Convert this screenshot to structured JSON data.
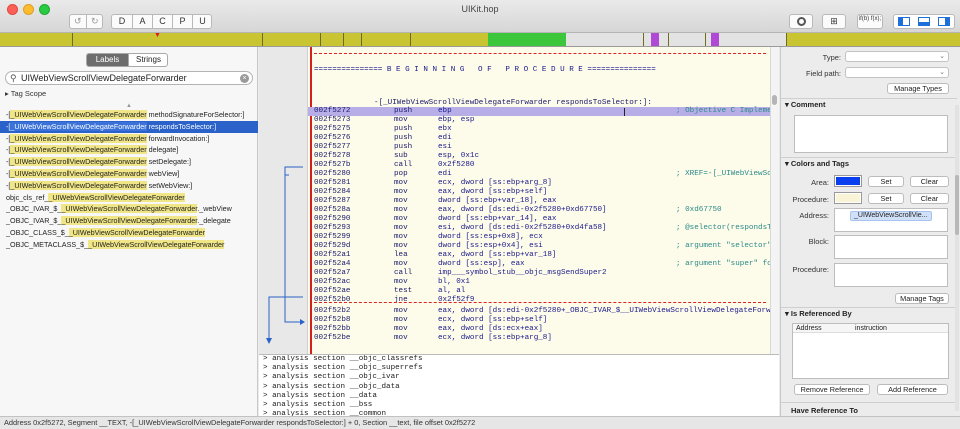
{
  "window": {
    "title": "UIKit.hop"
  },
  "toolbar": {
    "undo_icon": "undo-icon",
    "redo_icon": "redo-icon",
    "type_buttons": [
      "D",
      "A",
      "C",
      "P",
      "U"
    ],
    "right_icons": [
      "debug-icon",
      "control-flow-graph-icon",
      "pseudo-code-icon",
      "left-panel-toggle-icon",
      "bottom-panel-toggle-icon",
      "right-panel-toggle-icon"
    ],
    "pseudo_code_label": "if(b) f(x);"
  },
  "left": {
    "tabs": [
      "Labels",
      "Strings"
    ],
    "search_value": "UIWebViewScrollViewDelegateForwarder",
    "tag_scope": "Tag Scope",
    "symbols": [
      {
        "pre": "-[",
        "hl": "_UIWebViewScrollViewDelegateForwarder",
        "post": " methodSignatureForSelector:]"
      },
      {
        "pre": "-[",
        "hl": "_UIWebViewScrollViewDelegateForwarder",
        "post": " respondsToSelector:]"
      },
      {
        "pre": "-[",
        "hl": "_UIWebViewScrollViewDelegateForwarder",
        "post": " forwardInvocation:]"
      },
      {
        "pre": "-[",
        "hl": "_UIWebViewScrollViewDelegateForwarder",
        "post": " delegate]"
      },
      {
        "pre": "-[",
        "hl": "_UIWebViewScrollViewDelegateForwarder",
        "post": " setDelegate:]"
      },
      {
        "pre": "-[",
        "hl": "_UIWebViewScrollViewDelegateForwarder",
        "post": " webView]"
      },
      {
        "pre": "-[",
        "hl": "_UIWebViewScrollViewDelegateForwarder",
        "post": " setWebView:]"
      },
      {
        "pre": "objc_cls_ref_",
        "hl": "_UIWebViewScrollViewDelegateForwarder",
        "post": ""
      },
      {
        "pre": "_OBJC_IVAR_$_",
        "hl": "_UIWebViewScrollViewDelegateForwarder",
        "post": "._webView"
      },
      {
        "pre": "_OBJC_IVAR_$_",
        "hl": "_UIWebViewScrollViewDelegateForwarder",
        "post": "._delegate"
      },
      {
        "pre": "_OBJC_CLASS_$_",
        "hl": "_UIWebViewScrollViewDelegateForwarder",
        "post": ""
      },
      {
        "pre": "_OBJC_METACLASS_$_",
        "hl": "_UIWebViewScrollViewDelegateForwarder",
        "post": ""
      }
    ]
  },
  "code": {
    "banner": "=============== B E G I N N I N G   O F   P R O C E D U R E ===============",
    "proc_name": "-[_UIWebViewScrollViewDelegateForwarder respondsToSelector:]:",
    "lines": [
      {
        "addr": "002f5272",
        "mn": "push",
        "op": "ebp",
        "cm": "; Objective C Implemen"
      },
      {
        "addr": "002f5273",
        "mn": "mov",
        "op": "ebp, esp",
        "cm": ""
      },
      {
        "addr": "002f5275",
        "mn": "push",
        "op": "ebx",
        "cm": ""
      },
      {
        "addr": "002f5276",
        "mn": "push",
        "op": "edi",
        "cm": ""
      },
      {
        "addr": "002f5277",
        "mn": "push",
        "op": "esi",
        "cm": ""
      },
      {
        "addr": "002f5278",
        "mn": "sub",
        "op": "esp, 0x1c",
        "cm": ""
      },
      {
        "addr": "002f527b",
        "mn": "call",
        "op": "0x2f5280",
        "cm": ""
      },
      {
        "addr": "002f5280",
        "mn": "pop",
        "op": "edi",
        "cm": "; XREF=-[_UIWebViewScr"
      },
      {
        "addr": "002f5281",
        "mn": "mov",
        "op": "ecx, dword [ss:ebp+arg_8]",
        "cm": ""
      },
      {
        "addr": "002f5284",
        "mn": "mov",
        "op": "eax, dword [ss:ebp+self]",
        "cm": ""
      },
      {
        "addr": "002f5287",
        "mn": "mov",
        "op": "dword [ss:ebp+var_18], eax",
        "cm": ""
      },
      {
        "addr": "002f528a",
        "mn": "mov",
        "op": "eax, dword [ds:edi-0x2f5280+0xd67750]",
        "cm": "; 0xd67750"
      },
      {
        "addr": "002f5290",
        "mn": "mov",
        "op": "dword [ss:ebp+var_14], eax",
        "cm": ""
      },
      {
        "addr": "002f5293",
        "mn": "mov",
        "op": "esi, dword [ds:edi-0x2f5280+0xd4fa58]",
        "cm": "; @selector(respondsTo"
      },
      {
        "addr": "002f5299",
        "mn": "mov",
        "op": "dword [ss:esp+0x8], ecx",
        "cm": ""
      },
      {
        "addr": "002f529d",
        "mn": "mov",
        "op": "dword [ss:esp+0x4], esi",
        "cm": "; argument \"selector\""
      },
      {
        "addr": "002f52a1",
        "mn": "lea",
        "op": "eax, dword [ss:ebp+var_18]",
        "cm": ""
      },
      {
        "addr": "002f52a4",
        "mn": "mov",
        "op": "dword [ss:esp], eax",
        "cm": "; argument \"super\" for"
      },
      {
        "addr": "002f52a7",
        "mn": "call",
        "op": "imp___symbol_stub__objc_msgSendSuper2",
        "cm": ""
      },
      {
        "addr": "002f52ac",
        "mn": "mov",
        "op": "bl, 0x1",
        "cm": ""
      },
      {
        "addr": "002f52ae",
        "mn": "test",
        "op": "al, al",
        "cm": ""
      },
      {
        "addr": "002f52b0",
        "mn": "jne",
        "op": "0x2f52f9",
        "cm": ""
      }
    ],
    "lines2": [
      {
        "addr": "002f52b2",
        "mn": "mov",
        "op": "eax, dword [ds:edi-0x2f5280+_OBJC_IVAR_$__UIWebViewScrollViewDelegateForwa",
        "cm": ""
      },
      {
        "addr": "002f52b8",
        "mn": "mov",
        "op": "ecx, dword [ss:ebp+self]",
        "cm": ""
      },
      {
        "addr": "002f52bb",
        "mn": "mov",
        "op": "eax, dword [ds:ecx+eax]",
        "cm": ""
      },
      {
        "addr": "002f52be",
        "mn": "mov",
        "op": "ecx, dword [ss:ebp+arg_8]",
        "cm": ""
      }
    ]
  },
  "console": {
    "lines": [
      "> analysis section __objc_classrefs",
      "> analysis section __objc_superrefs",
      "> analysis section __objc_ivar",
      "> analysis section __objc_data",
      "> analysis section __data",
      "> analysis section __bss",
      "> analysis section __common"
    ]
  },
  "inspector": {
    "type_label": "Type:",
    "field_path_label": "Field path:",
    "manage_types": "Manage Types",
    "comment_title": "Comment",
    "colors_tags_title": "Colors and Tags",
    "area_label": "Area:",
    "procedure_label": "Procedure:",
    "set_label": "Set",
    "clear_label": "Clear",
    "address_label": "Address:",
    "address_tag": "_UIWebViewScrollVie...",
    "block_label": "Block:",
    "procedure_tag_label": "Procedure:",
    "manage_tags": "Manage Tags",
    "referenced_by_title": "Is Referenced By",
    "ref_headers": [
      "Address",
      "instruction"
    ],
    "remove_reference": "Remove Reference",
    "add_reference": "Add Reference",
    "have_reference_title": "Have Reference To",
    "area_color": "#0a3ff0",
    "procedure_color": "#fbf3d6"
  },
  "status": {
    "text": "Address 0x2f5272, Segment __TEXT, -[_UIWebViewScrollViewDelegateForwarder respondsToSelector:] + 0, Section __text, file offset 0x2f5272"
  }
}
